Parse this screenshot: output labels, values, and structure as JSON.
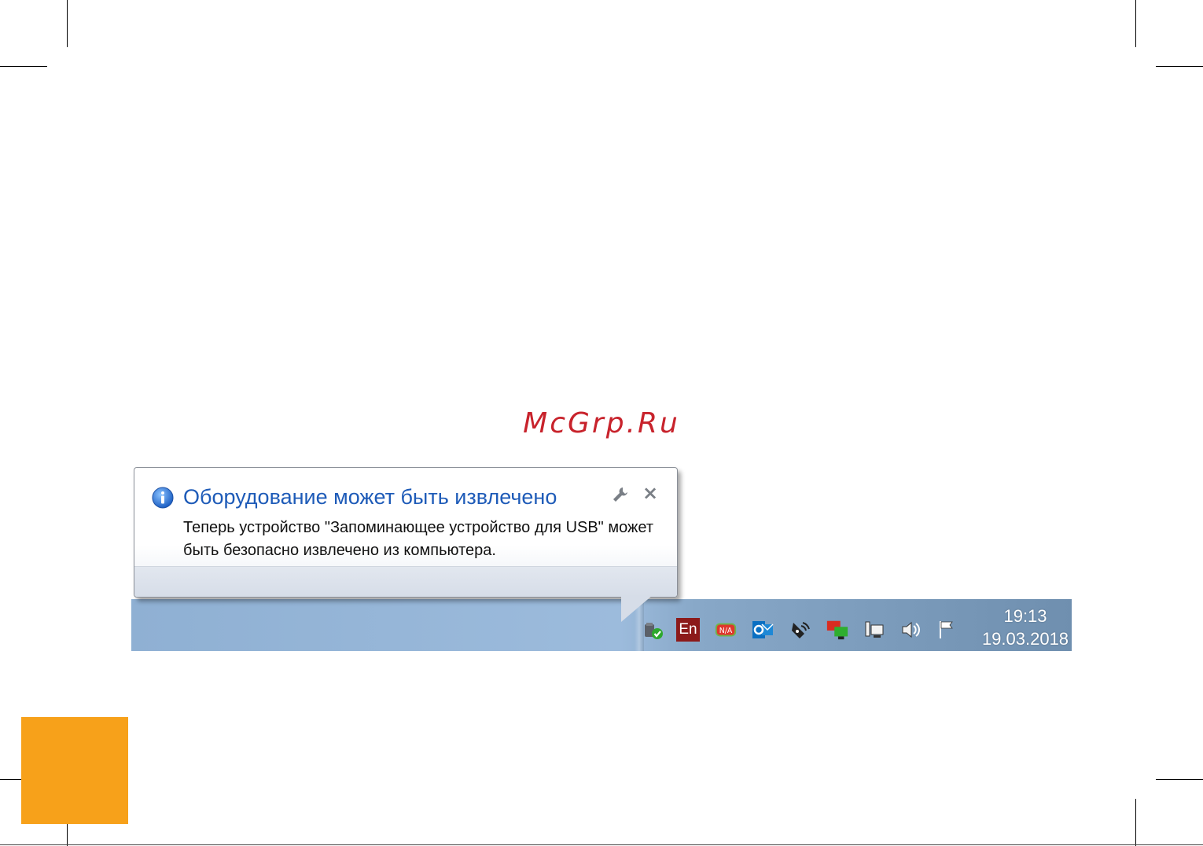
{
  "watermark": "McGrp.Ru",
  "balloon": {
    "title": "Оборудование может быть извлечено",
    "body": "Теперь устройство \"Запоминающее устройство для USB\" может быть безопасно извлечено из компьютера.",
    "close_label": "×"
  },
  "tray": {
    "language_label": "En",
    "na_label": "N/A",
    "icons": [
      "safely-remove-hardware-icon",
      "language-indicator-icon",
      "na-icon",
      "outlook-icon",
      "network-satellite-icon",
      "display-switch-icon",
      "network-icon",
      "volume-icon",
      "action-center-flag-icon"
    ]
  },
  "clock": {
    "time": "19:13",
    "date": "19.03.2018"
  },
  "colors": {
    "accent_orange": "#f7a11a",
    "watermark_red": "#c8232c",
    "title_blue": "#1e5bb8"
  }
}
